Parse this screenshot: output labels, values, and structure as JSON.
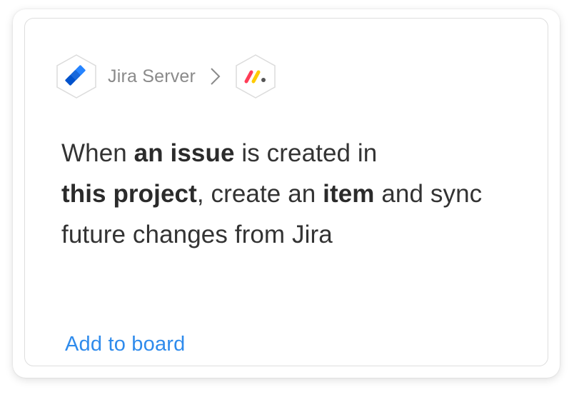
{
  "integration": {
    "source_name": "Jira Server",
    "source_icon": "jira-logo-icon",
    "separator_icon": "chevron-right-icon",
    "target_icon": "monday-logo-icon"
  },
  "recipe": {
    "part1": "When ",
    "field1": "an issue",
    "part2": " is created in",
    "field2": "this project",
    "part3": ", create an ",
    "field3": "item",
    "part4": " and sync future changes from Jira"
  },
  "actions": {
    "add_label": "Add to board"
  },
  "colors": {
    "link": "#2f8bec",
    "jira_blue": "#2684ff",
    "jira_dark": "#0052cc",
    "monday_red": "#ff3d57",
    "monday_yellow": "#ffcb00",
    "monday_green": "#00ca72"
  }
}
